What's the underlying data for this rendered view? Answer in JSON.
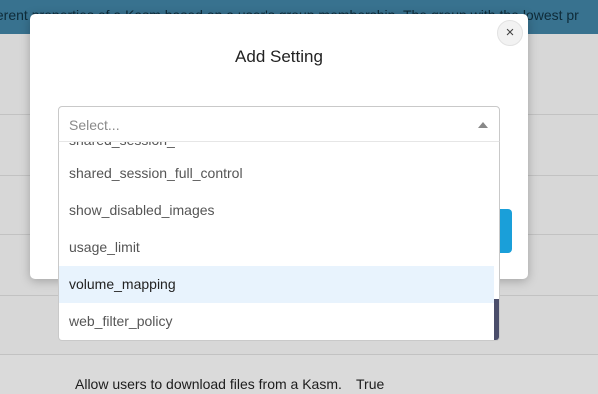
{
  "background": {
    "banner_text": "ferent properties of a Kasm based on a user's group membership. The group with the lowest pr",
    "bottom_row": {
      "description": "Allow users to download files from a Kasm.",
      "value": "True"
    }
  },
  "modal": {
    "title": "Add Setting",
    "close_label": "×",
    "select": {
      "placeholder": "Select...",
      "options": [
        "shared_session_full_control",
        "show_disabled_images",
        "usage_limit",
        "volume_mapping",
        "web_filter_policy"
      ],
      "focused_option": "volume_mapping"
    }
  },
  "colors": {
    "banner": "#3f7fa0",
    "save_button": "#1a9fd9",
    "focused_option_bg": "#e8f3fd",
    "scroll_thumb": "#4a4d6a"
  }
}
